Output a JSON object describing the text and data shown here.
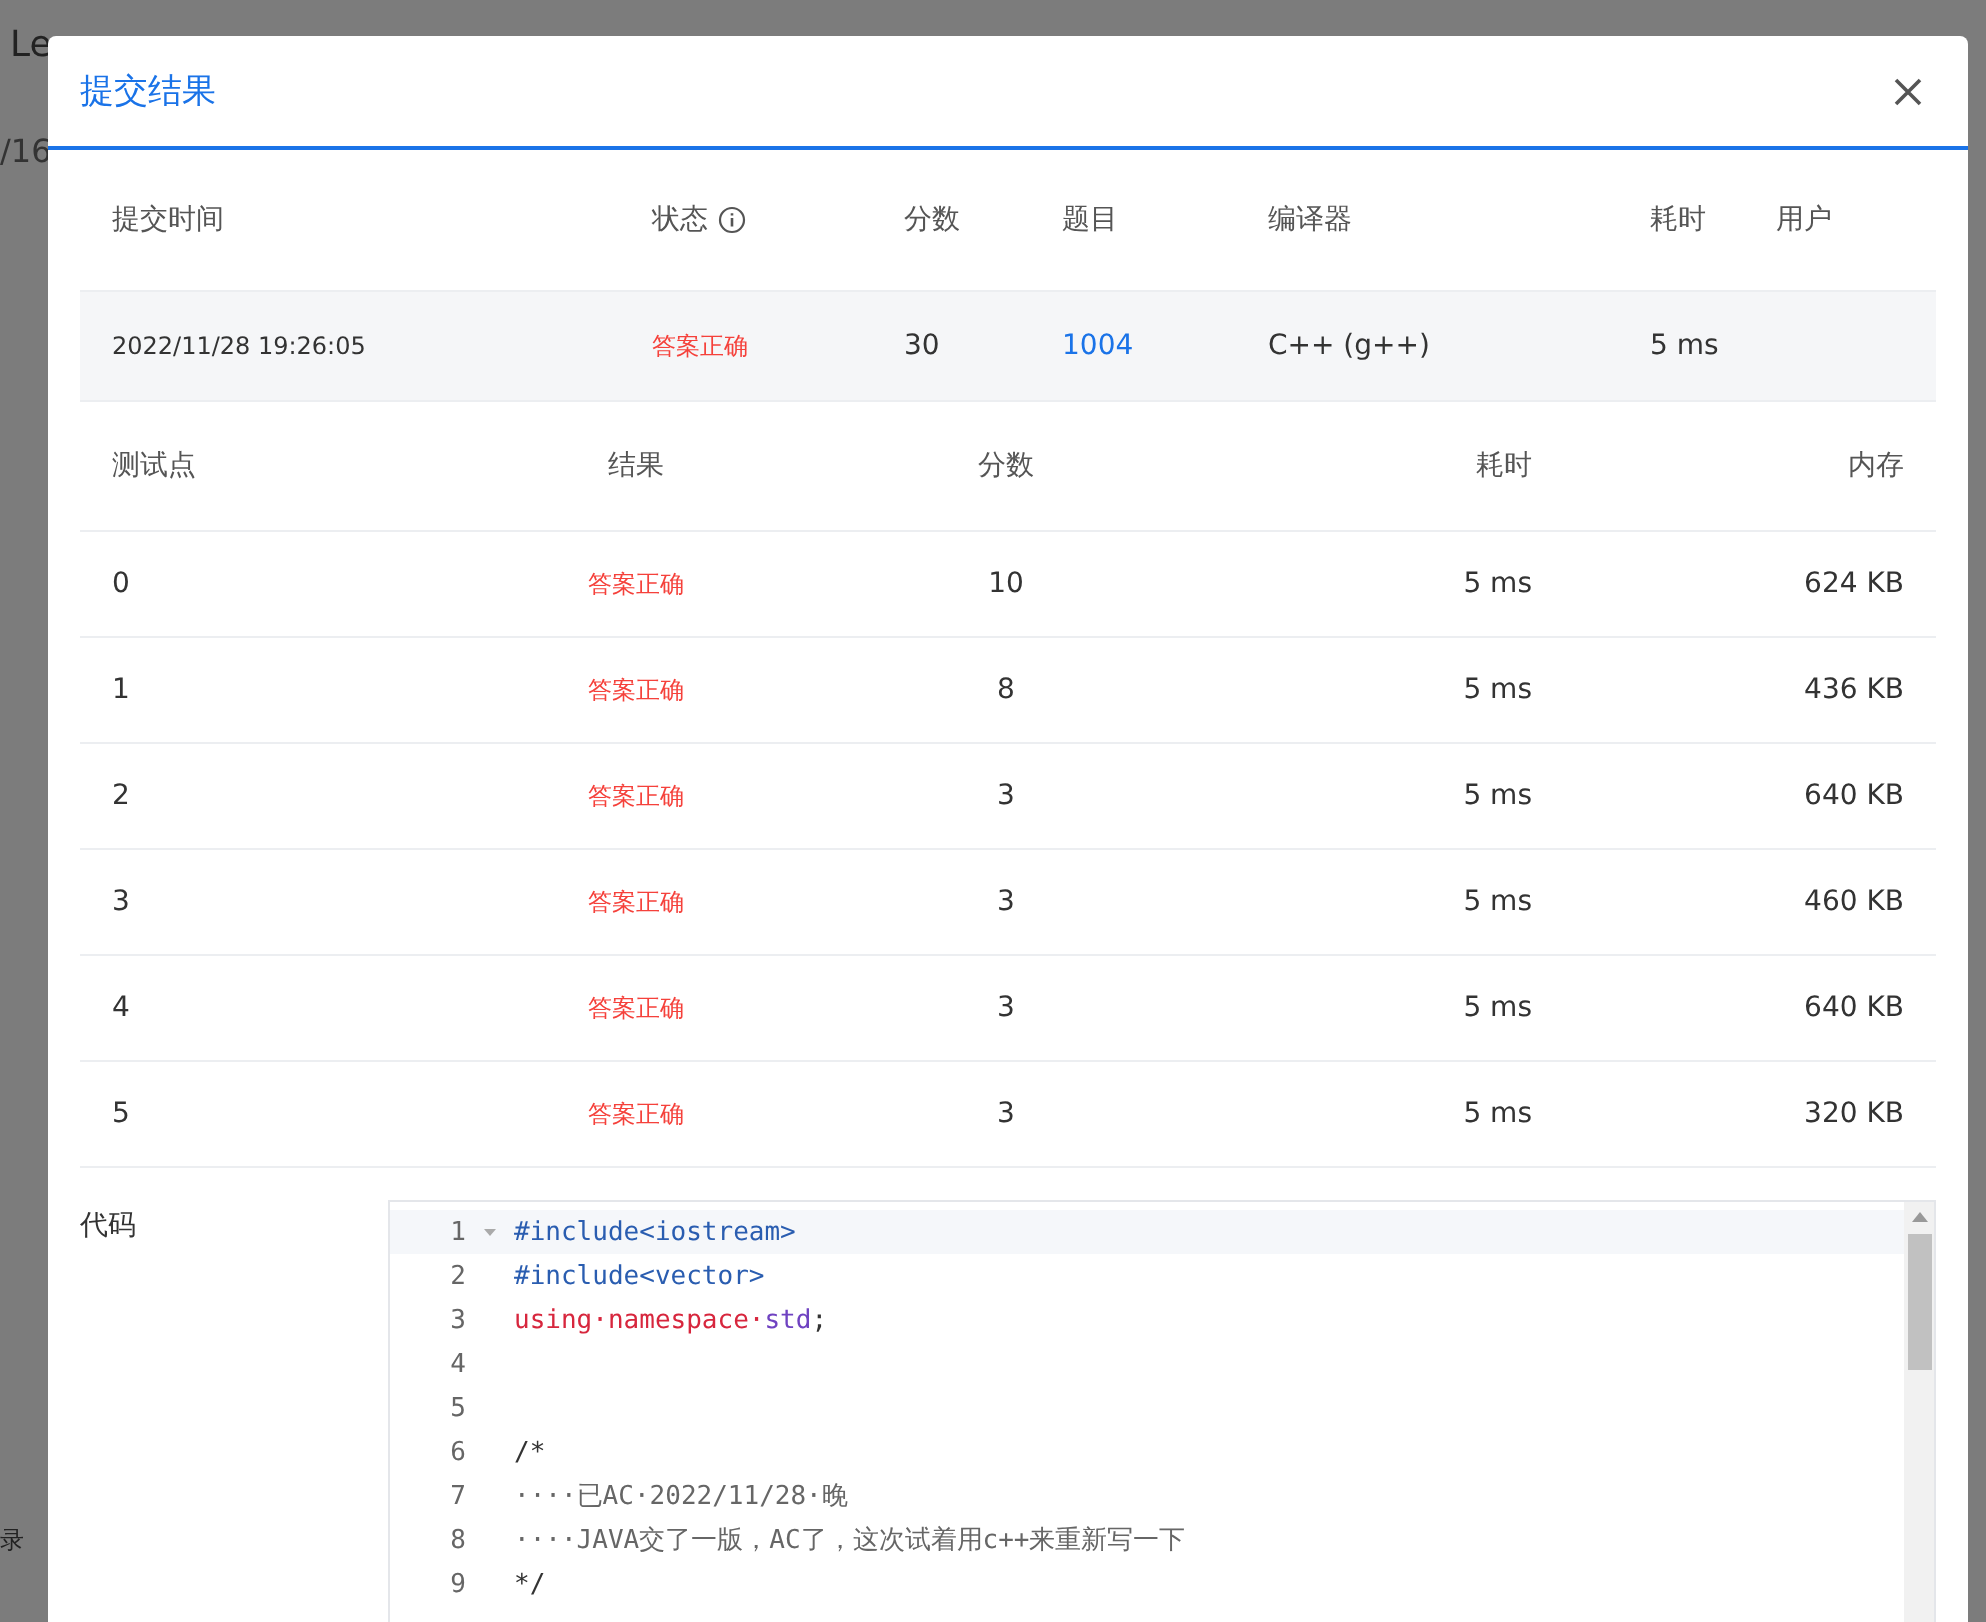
{
  "background": {
    "texts": [
      "Le",
      "/16",
      "录"
    ]
  },
  "dialog": {
    "title": "提交结果",
    "submission": {
      "columns": [
        "提交时间",
        "状态",
        "分数",
        "题目",
        "编译器",
        "耗时",
        "用户"
      ],
      "row": {
        "time": "2022/11/28 19:26:05",
        "status": "答案正确",
        "score": "30",
        "problem": "1004",
        "compiler": "C++ (g++)",
        "duration": "5 ms"
      }
    },
    "tests": {
      "columns": [
        "测试点",
        "结果",
        "分数",
        "耗时",
        "内存"
      ],
      "rows": [
        {
          "id": "0",
          "result": "答案正确",
          "score": "10",
          "duration": "5 ms",
          "memory": "624 KB"
        },
        {
          "id": "1",
          "result": "答案正确",
          "score": "8",
          "duration": "5 ms",
          "memory": "436 KB"
        },
        {
          "id": "2",
          "result": "答案正确",
          "score": "3",
          "duration": "5 ms",
          "memory": "640 KB"
        },
        {
          "id": "3",
          "result": "答案正确",
          "score": "3",
          "duration": "5 ms",
          "memory": "460 KB"
        },
        {
          "id": "4",
          "result": "答案正确",
          "score": "3",
          "duration": "5 ms",
          "memory": "640 KB"
        },
        {
          "id": "5",
          "result": "答案正确",
          "score": "3",
          "duration": "5 ms",
          "memory": "320 KB"
        }
      ]
    },
    "code": {
      "label": "代码",
      "lines": [
        {
          "number": "1",
          "tokens": [
            {
              "kind": "directive",
              "text": "#include<iostream>"
            }
          ]
        },
        {
          "number": "2",
          "tokens": [
            {
              "kind": "directive",
              "text": "#include<vector>"
            }
          ]
        },
        {
          "number": "3",
          "tokens": [
            {
              "kind": "keyword",
              "text": "using·namespace·"
            },
            {
              "kind": "name",
              "text": "std"
            },
            {
              "kind": "plain",
              "text": ";"
            }
          ]
        },
        {
          "number": "4"
        },
        {
          "number": "5"
        },
        {
          "number": "6",
          "tokens": [
            {
              "kind": "plain",
              "text": "/*"
            }
          ]
        },
        {
          "number": "7",
          "tokens": [
            {
              "kind": "comment",
              "text": "····已AC·2022/11/28·晚"
            }
          ]
        },
        {
          "number": "8",
          "tokens": [
            {
              "kind": "comment",
              "text": "····JAVA交了一版，AC了，这次试着用c++来重新写一下"
            }
          ]
        },
        {
          "number": "9",
          "tokens": [
            {
              "kind": "plain",
              "text": "*/"
            }
          ]
        }
      ]
    }
  }
}
